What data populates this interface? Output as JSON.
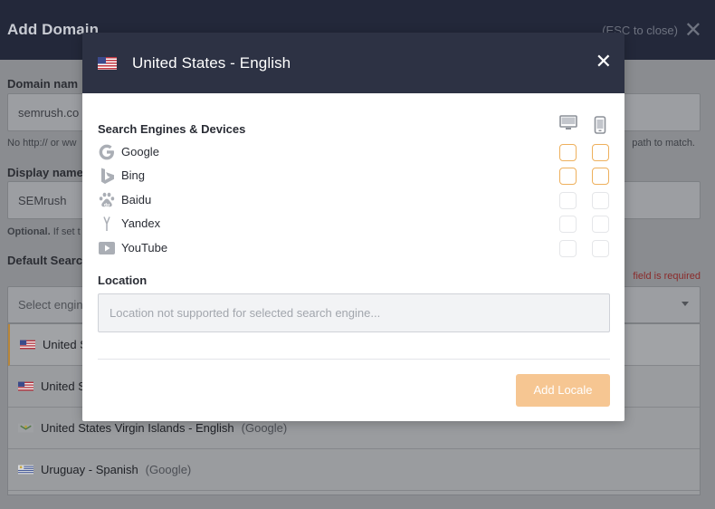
{
  "background": {
    "title": "Add Domain",
    "esc_hint": "(ESC to close)",
    "domain_label": "Domain nam",
    "domain_value": "semrush.co",
    "domain_hint_left": "No http:// or ww",
    "domain_hint_right": "path to match.",
    "display_label": "Display name",
    "display_value": "SEMrush",
    "optional_bold": "Optional.",
    "optional_rest": " If set t",
    "default_search_label": "Default Searc",
    "required_text": "field is required",
    "select_placeholder": "Select engin",
    "locales": [
      {
        "country": "United S",
        "engine": ""
      },
      {
        "country": "United S",
        "engine": ""
      },
      {
        "country": "United States Virgin Islands - English",
        "engine": "(Google)"
      },
      {
        "country": "Uruguay - Spanish",
        "engine": "(Google)"
      }
    ]
  },
  "modal": {
    "title": "United States - English",
    "close_glyph": "✕",
    "engines_title": "Search Engines & Devices",
    "engines": [
      {
        "name": "Google",
        "icon": "google-icon",
        "desktop": true,
        "mobile": true
      },
      {
        "name": "Bing",
        "icon": "bing-icon",
        "desktop": true,
        "mobile": true
      },
      {
        "name": "Baidu",
        "icon": "baidu-icon",
        "desktop": false,
        "mobile": false
      },
      {
        "name": "Yandex",
        "icon": "yandex-icon",
        "desktop": false,
        "mobile": false
      },
      {
        "name": "YouTube",
        "icon": "youtube-icon",
        "desktop": false,
        "mobile": false
      }
    ],
    "location_title": "Location",
    "location_placeholder": "Location not supported for selected search engine...",
    "add_button": "Add Locale"
  },
  "colors": {
    "header_bg": "#2d3244",
    "checkbox_active": "#eeb05c",
    "button_bg": "#f6c692"
  }
}
